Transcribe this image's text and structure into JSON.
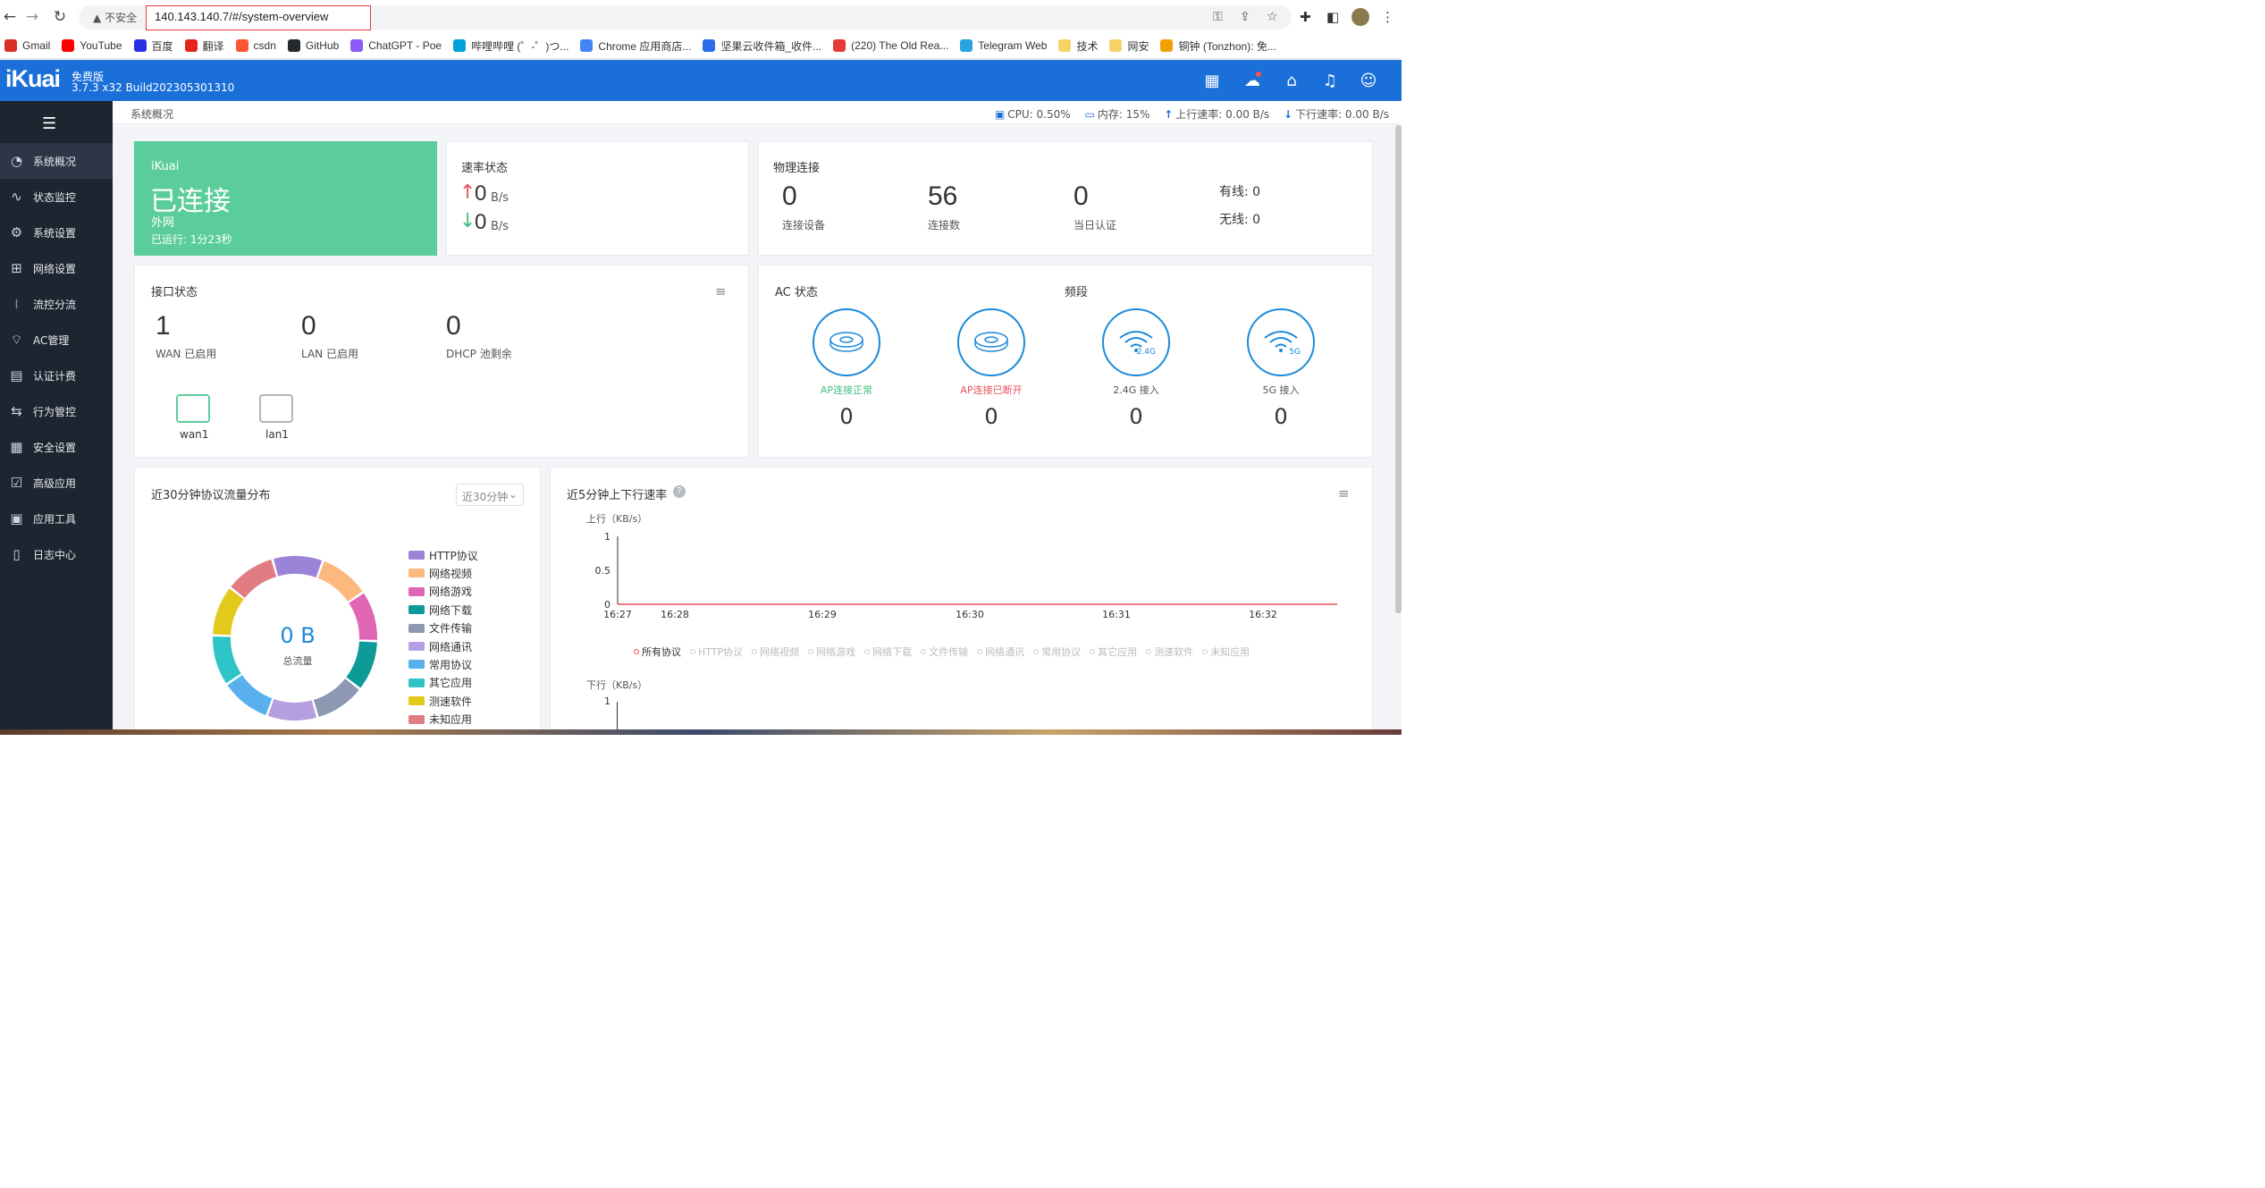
{
  "browser": {
    "insecure_label": "不安全",
    "url": "140.143.140.7/#/system-overview",
    "bookmarks": [
      {
        "label": "Gmail",
        "icon": "gmail-icon",
        "color": "#d93025"
      },
      {
        "label": "YouTube",
        "icon": "youtube-icon",
        "color": "#ff0000"
      },
      {
        "label": "百度",
        "icon": "baidu-icon",
        "color": "#2932e1"
      },
      {
        "label": "翻译",
        "icon": "translate-icon",
        "color": "#e5231b"
      },
      {
        "label": "csdn",
        "icon": "csdn-icon",
        "color": "#fc5531"
      },
      {
        "label": "GitHub",
        "icon": "github-icon",
        "color": "#24292e"
      },
      {
        "label": "ChatGPT - Poe",
        "icon": "poe-icon",
        "color": "#8b5cf6"
      },
      {
        "label": "哔哩哔哩 (゜-゜)つ...",
        "icon": "bilibili-icon",
        "color": "#00a1d6"
      },
      {
        "label": "Chrome 应用商店...",
        "icon": "chrome-store-icon",
        "color": "#4285f4"
      },
      {
        "label": "坚果云收件箱_收件...",
        "icon": "jianguoyun-icon",
        "color": "#2b6ee8"
      },
      {
        "label": "(220) The Old Rea...",
        "icon": "bookmark-site-icon",
        "color": "#e53935"
      },
      {
        "label": "Telegram Web",
        "icon": "telegram-icon",
        "color": "#2aa3e0"
      },
      {
        "label": "技术",
        "icon": "folder-icon",
        "color": "#f6d365"
      },
      {
        "label": "网安",
        "icon": "folder-icon",
        "color": "#f6d365"
      },
      {
        "label": "铜钟 (Tonzhon): 免...",
        "icon": "bell-site-icon",
        "color": "#f29f05"
      }
    ]
  },
  "app": {
    "logo": "iKuai",
    "edition": "免费版",
    "build": "3.7.3 x32 Build202305301310",
    "header_icons": [
      "qrcode-icon",
      "cloud-icon",
      "home-icon",
      "bell-icon",
      "user-icon"
    ]
  },
  "sidebar": {
    "items": [
      {
        "label": "系统概况",
        "icon": "dashboard-icon",
        "active": true
      },
      {
        "label": "状态监控",
        "icon": "monitor-icon"
      },
      {
        "label": "系统设置",
        "icon": "gear-icon"
      },
      {
        "label": "网络设置",
        "icon": "network-icon"
      },
      {
        "label": "流控分流",
        "icon": "sliders-icon"
      },
      {
        "label": "AC管理",
        "icon": "wifi-icon"
      },
      {
        "label": "认证计费",
        "icon": "id-card-icon"
      },
      {
        "label": "行为管控",
        "icon": "arrows-icon"
      },
      {
        "label": "安全设置",
        "icon": "firewall-icon"
      },
      {
        "label": "高级应用",
        "icon": "check-square-icon"
      },
      {
        "label": "应用工具",
        "icon": "apps-icon"
      },
      {
        "label": "日志中心",
        "icon": "document-icon"
      }
    ]
  },
  "topbar": {
    "breadcrumb": "系统概况",
    "cpu": "CPU: 0.50%",
    "memory": "内存: 15%",
    "upload": "上行速率: 0.00 B/s",
    "download": "下行速率: 0.00 B/s"
  },
  "network_card": {
    "name": "iKuai",
    "status": "已连接",
    "type": "外网",
    "uptime": "已运行: 1分23秒",
    "color": "#5bcd9b"
  },
  "speed_card": {
    "title": "速率状态",
    "up_value": "0",
    "up_unit": "B/s",
    "down_value": "0",
    "down_unit": "B/s"
  },
  "physical_card": {
    "title": "物理连接",
    "metrics": [
      {
        "value": "0",
        "label": "连接设备"
      },
      {
        "value": "56",
        "label": "连接数"
      },
      {
        "value": "0",
        "label": "当日认证"
      }
    ],
    "wired": "有线: 0",
    "wireless": "无线: 0"
  },
  "interface_card": {
    "title": "接口状态",
    "metrics": [
      {
        "value": "1",
        "label": "WAN 已启用"
      },
      {
        "value": "0",
        "label": "LAN 已启用"
      },
      {
        "value": "0",
        "label": "DHCP 池剩余"
      }
    ],
    "ports": [
      {
        "label": "wan1",
        "color": "#5bcd9b"
      },
      {
        "label": "lan1",
        "color": "#b5b5b5"
      }
    ]
  },
  "ac_card": {
    "title": "AC 状态",
    "band_title": "频段",
    "items": [
      {
        "icon_text": "",
        "label": "AP连接正常",
        "value": "0",
        "color": "#3cbf7f"
      },
      {
        "icon_text": "",
        "label": "AP连接已断开",
        "value": "0",
        "color": "#e8505b"
      },
      {
        "icon_text": "2.4G",
        "label": "2.4G 接入",
        "value": "0",
        "color": "#555555"
      },
      {
        "icon_text": "5G",
        "label": "5G 接入",
        "value": "0",
        "color": "#555555"
      }
    ]
  },
  "protocol_card": {
    "title": "近30分钟协议流量分布",
    "range_select": "近30分钟",
    "total_value": "0 B",
    "total_label": "总流量",
    "legend": [
      {
        "label": "HTTP协议",
        "color": "#9b84d8"
      },
      {
        "label": "网络视频",
        "color": "#fdb97d"
      },
      {
        "label": "网络游戏",
        "color": "#e066b3"
      },
      {
        "label": "网络下载",
        "color": "#0f9a9a"
      },
      {
        "label": "文件传输",
        "color": "#8d98b3"
      },
      {
        "label": "网络通讯",
        "color": "#b69fe0"
      },
      {
        "label": "常用协议",
        "color": "#59b0ef"
      },
      {
        "label": "其它应用",
        "color": "#2fc4c8"
      },
      {
        "label": "测速软件",
        "color": "#e3c919"
      },
      {
        "label": "未知应用",
        "color": "#e07c82"
      }
    ]
  },
  "rate_card": {
    "title": "近5分钟上下行速率",
    "up_axis_label": "上行（KB/s）",
    "down_axis_label": "下行（KB/s）",
    "yticks": [
      "1",
      "0.5",
      "0"
    ],
    "down_ytick": "1",
    "xticks": [
      "16:27",
      "16:28",
      "16:29",
      "16:30",
      "16:31",
      "16:32"
    ],
    "protocols": [
      "所有协议",
      "HTTP协议",
      "网络视频",
      "网络游戏",
      "网络下载",
      "文件传输",
      "网络通讯",
      "常用协议",
      "其它应用",
      "测速软件",
      "未知应用"
    ],
    "line_color": "#e8505b"
  },
  "chart_data": [
    {
      "type": "pie",
      "title": "近30分钟协议流量分布",
      "categories": [
        "HTTP协议",
        "网络视频",
        "网络游戏",
        "网络下载",
        "文件传输",
        "网络通讯",
        "常用协议",
        "其它应用",
        "测速软件",
        "未知应用"
      ],
      "values": [
        0,
        0,
        0,
        0,
        0,
        0,
        0,
        0,
        0,
        0
      ],
      "legend": "right"
    },
    {
      "type": "line",
      "title": "近5分钟上下行速率",
      "ylabel": "上行（KB/s）",
      "x": [
        "16:27",
        "16:28",
        "16:29",
        "16:30",
        "16:31",
        "16:32"
      ],
      "series": [
        {
          "name": "所有协议",
          "values": [
            0,
            0,
            0,
            0,
            0,
            0
          ]
        }
      ],
      "ylim": [
        0,
        1
      ],
      "grid": false,
      "legend": "bottom"
    }
  ]
}
